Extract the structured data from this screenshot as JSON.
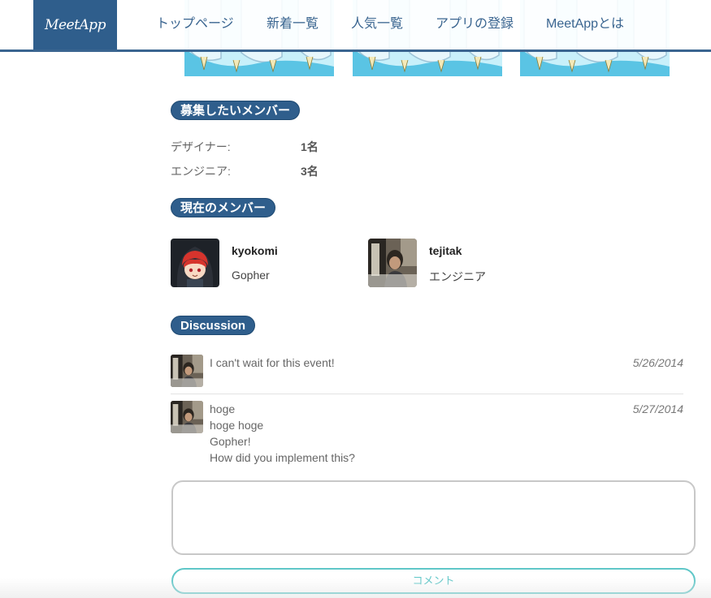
{
  "header": {
    "logo": "MeetApp",
    "nav": [
      "トップページ",
      "新着一覧",
      "人気一覧",
      "アプリの登録",
      "MeetAppとは"
    ]
  },
  "recruit": {
    "title": "募集したいメンバー",
    "rows": [
      {
        "label": "デザイナー:",
        "value": "1名"
      },
      {
        "label": "エンジニア:",
        "value": "3名"
      }
    ]
  },
  "members": {
    "title": "現在のメンバー",
    "list": [
      {
        "name": "kyokomi",
        "role": "Gopher"
      },
      {
        "name": "tejitak",
        "role": "エンジニア"
      }
    ]
  },
  "discussion": {
    "title": "Discussion",
    "comments": [
      {
        "lines": [
          "I can't wait for this event!"
        ],
        "date": "5/26/2014"
      },
      {
        "lines": [
          "hoge",
          "hoge hoge",
          "Gopher!",
          "How did you implement this?"
        ],
        "date": "5/27/2014"
      }
    ],
    "input_placeholder": "",
    "submit_label": "コメント"
  },
  "colors": {
    "brand": "#2f5e8c",
    "accent": "#5fc7c8",
    "screenshot_bg": "#c8f0fa"
  }
}
